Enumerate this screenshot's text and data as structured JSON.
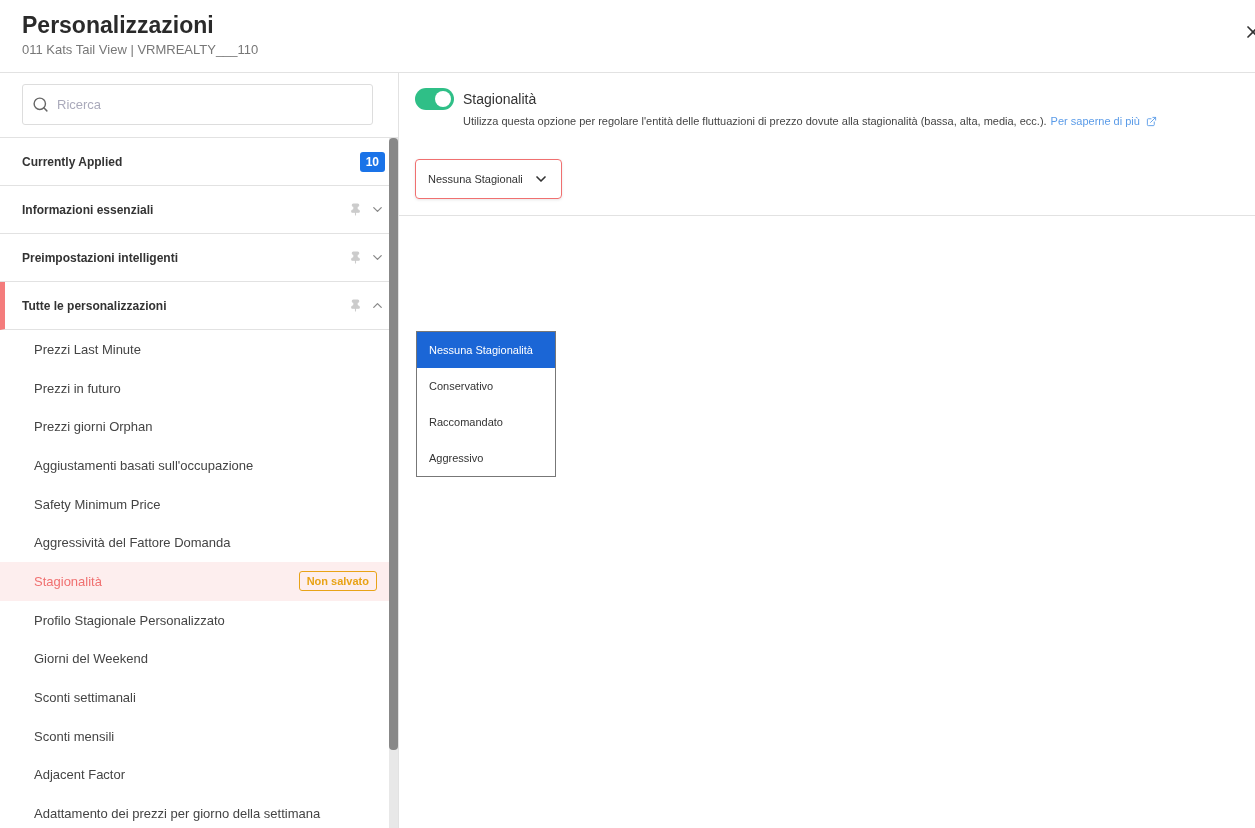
{
  "header": {
    "title": "Personalizzazioni",
    "subtitle": "011 Kats Tail View | VRMREALTY___110"
  },
  "sidebar": {
    "search": {
      "placeholder": "Ricerca"
    },
    "sections": [
      {
        "label": "Currently Applied",
        "badge": "10",
        "kind": "count",
        "selected": false
      },
      {
        "label": "Informazioni essenziali",
        "kind": "group",
        "expanded": false,
        "selected": false
      },
      {
        "label": "Preimpostazioni intelligenti",
        "kind": "group",
        "expanded": false,
        "selected": false
      },
      {
        "label": "Tutte le personalizzazioni",
        "kind": "group",
        "expanded": true,
        "selected": true,
        "children": [
          {
            "label": "Prezzi Last Minute",
            "selected": false
          },
          {
            "label": "Prezzi in futuro",
            "selected": false
          },
          {
            "label": "Prezzi giorni Orphan",
            "selected": false
          },
          {
            "label": "Aggiustamenti basati sull'occupazione",
            "selected": false
          },
          {
            "label": "Safety Minimum Price",
            "selected": false
          },
          {
            "label": "Aggressività del Fattore Domanda",
            "selected": false
          },
          {
            "label": "Stagionalità",
            "selected": true,
            "badge": "Non salvato"
          },
          {
            "label": "Profilo Stagionale Personalizzato",
            "selected": false
          },
          {
            "label": "Giorni del Weekend",
            "selected": false
          },
          {
            "label": "Sconti settimanali",
            "selected": false
          },
          {
            "label": "Sconti mensili",
            "selected": false
          },
          {
            "label": "Adjacent Factor",
            "selected": false
          },
          {
            "label": "Adattamento dei prezzi per giorno della settimana",
            "selected": false
          }
        ]
      }
    ]
  },
  "setting": {
    "title": "Stagionalità",
    "on": true,
    "description": "Utilizza questa opzione per regolare l'entità delle fluttuazioni di prezzo dovute alla stagionalità (bassa, alta, media, ecc.).",
    "link": "Per saperne di più",
    "select": {
      "value": "Nessuna Stagionali",
      "expanded": true,
      "options": [
        {
          "label": "Nessuna Stagionalità",
          "selected": true
        },
        {
          "label": "Conservativo",
          "selected": false
        },
        {
          "label": "Raccomandato",
          "selected": false
        },
        {
          "label": "Aggressivo",
          "selected": false
        }
      ]
    }
  }
}
